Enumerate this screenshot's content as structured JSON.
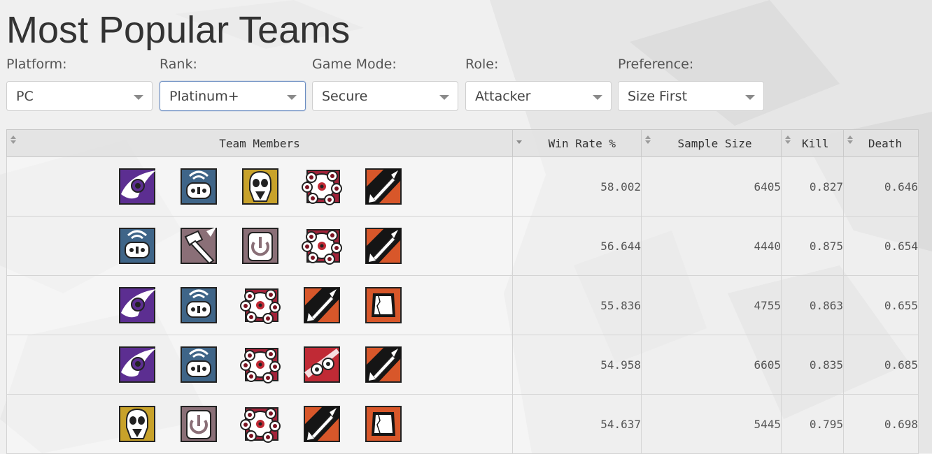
{
  "page": {
    "title": "Most Popular Teams"
  },
  "filters": [
    {
      "id": "platform",
      "label": "Platform:",
      "value": "PC",
      "active": false
    },
    {
      "id": "rank",
      "label": "Rank:",
      "value": "Platinum+",
      "active": true
    },
    {
      "id": "game_mode",
      "label": "Game Mode:",
      "value": "Secure",
      "active": false
    },
    {
      "id": "role",
      "label": "Role:",
      "value": "Attacker",
      "active": false
    },
    {
      "id": "preference",
      "label": "Preference:",
      "value": "Size First",
      "active": false
    }
  ],
  "table": {
    "columns": [
      {
        "key": "members",
        "label": "Team Members",
        "sort": "none"
      },
      {
        "key": "win_rate",
        "label": "Win Rate %",
        "sort": "desc"
      },
      {
        "key": "sample_size",
        "label": "Sample Size",
        "sort": "none"
      },
      {
        "key": "kill",
        "label": "Kill",
        "sort": "none"
      },
      {
        "key": "death",
        "label": "Death",
        "sort": "none"
      }
    ],
    "rows": [
      {
        "members": [
          "purple-eye-operator-icon",
          "drone-operator-icon",
          "skull-operator-icon",
          "cluster-operator-icon",
          "rocket-operator-icon"
        ],
        "win_rate": "58.002",
        "sample_size": "6405",
        "kill": "0.827",
        "death": "0.646"
      },
      {
        "members": [
          "drone-operator-icon",
          "hammer-operator-icon",
          "power-operator-icon",
          "cluster-operator-icon",
          "rocket-operator-icon"
        ],
        "win_rate": "56.644",
        "sample_size": "4440",
        "kill": "0.875",
        "death": "0.654"
      },
      {
        "members": [
          "purple-eye-operator-icon",
          "drone-operator-icon",
          "cluster-operator-icon",
          "rocket-operator-icon",
          "breach-operator-icon"
        ],
        "win_rate": "55.836",
        "sample_size": "4755",
        "kill": "0.863",
        "death": "0.655"
      },
      {
        "members": [
          "purple-eye-operator-icon",
          "drone-operator-icon",
          "cluster-operator-icon",
          "grenade-operator-icon",
          "rocket-operator-icon"
        ],
        "win_rate": "54.958",
        "sample_size": "6605",
        "kill": "0.835",
        "death": "0.685"
      },
      {
        "members": [
          "skull-operator-icon",
          "power-operator-icon",
          "cluster-operator-icon",
          "rocket-operator-icon",
          "breach-operator-icon"
        ],
        "win_rate": "54.637",
        "sample_size": "5445",
        "kill": "0.795",
        "death": "0.698"
      }
    ]
  },
  "colors": {
    "purple": "#5c2e91",
    "steel_blue": "#3f6588",
    "gold": "#c8a22a",
    "crimson": "#a3233a",
    "orange": "#d8572a",
    "mauve": "#8a6f77",
    "red": "#c02a35"
  }
}
